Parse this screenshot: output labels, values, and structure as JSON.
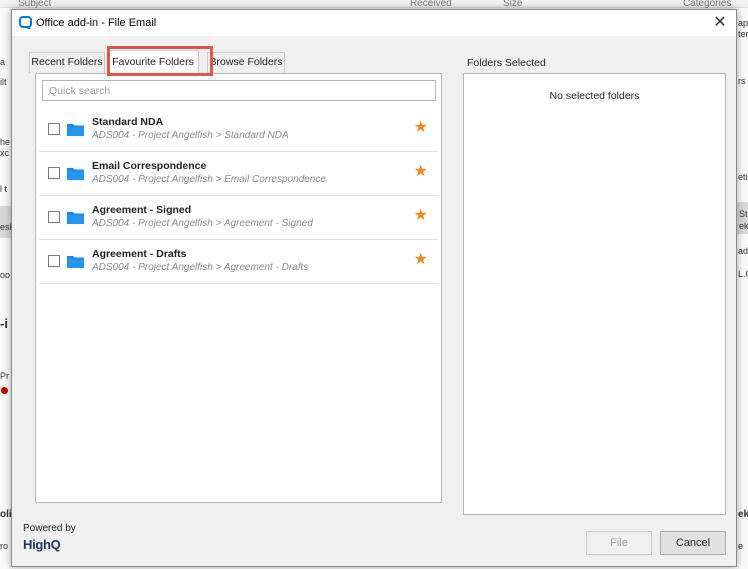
{
  "background": {
    "columns": [
      "Subject",
      "Received",
      "Size",
      "Categories"
    ],
    "left_fragments": [
      "a",
      "ilt",
      "he",
      "xc",
      "l t",
      "esl",
      "oo",
      "-i",
      "Pr",
      "oli",
      "ro"
    ],
    "right_fragments": [
      "ap,",
      "ter",
      "rs",
      "eti",
      "St",
      "ek(",
      "ad",
      "L.G",
      "ek",
      "e "
    ]
  },
  "dialog": {
    "title": "Office add-in - File Email",
    "close_glyph": "✕",
    "tabs": [
      {
        "label": "Recent Folders"
      },
      {
        "label": "Favourite Folders"
      },
      {
        "label": "Browse Folders"
      }
    ],
    "search": {
      "placeholder": "Quick search",
      "value": ""
    },
    "folders": [
      {
        "name": "Standard NDA",
        "path": "ADS004 - Project Angelfish > Standard NDA",
        "icon": "folder-icon"
      },
      {
        "name": "Email Correspondence",
        "path": "ADS004 - Project Angelfish > Email Correspondence",
        "icon": "folder-icon"
      },
      {
        "name": "Agreement - Signed",
        "path": "ADS004 - Project Angelfish > Agreement - Signed",
        "icon": "folder-icon"
      },
      {
        "name": "Agreement - Drafts",
        "path": "ADS004 - Project Angelfish > Agreement - Drafts",
        "icon": "folder-icon"
      }
    ],
    "star_glyph": "★",
    "selected_panel": {
      "label": "Folders Selected",
      "empty_text": "No selected folders"
    },
    "footer": {
      "powered_by": "Powered by",
      "brand": "HighQ",
      "file_button": "File",
      "cancel_button": "Cancel"
    }
  },
  "colors": {
    "accent": "#0078d7",
    "star": "#f08a1c",
    "highlight": "#e0574a",
    "brand": "#1f3864"
  }
}
